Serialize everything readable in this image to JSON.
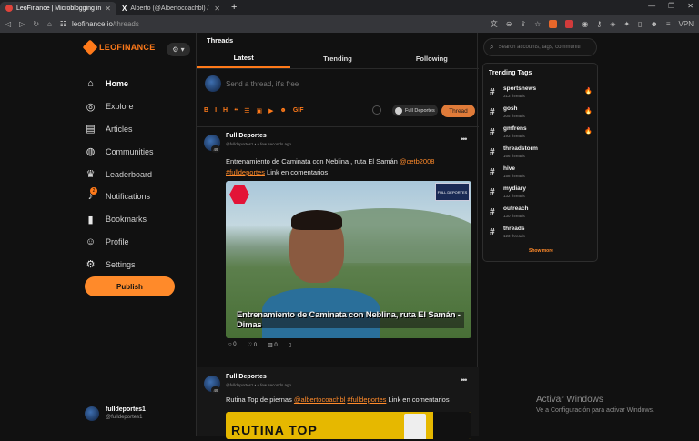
{
  "browser": {
    "tabs": [
      {
        "title": "LeoFinance | Microblogging in Bl",
        "close": "✕"
      },
      {
        "title": "Alberto (@Albertocoachbl) / X",
        "close": "✕"
      }
    ],
    "new_tab": "+",
    "url_host": "leofinance.io",
    "url_path": "/threads",
    "vpn_label": "VPN",
    "window_controls": [
      "—",
      "❐",
      "✕"
    ]
  },
  "sidebar": {
    "logo_text": "LEOFINANCE",
    "settings_button": "⚙ ▾",
    "nav": [
      {
        "label": "Home",
        "icon": "home-icon",
        "glyph": "⌂"
      },
      {
        "label": "Explore",
        "icon": "compass-icon",
        "glyph": "◎"
      },
      {
        "label": "Articles",
        "icon": "newspaper-icon",
        "glyph": "▤"
      },
      {
        "label": "Communities",
        "icon": "globe-icon",
        "glyph": "◍"
      },
      {
        "label": "Leaderboard",
        "icon": "trophy-icon",
        "glyph": "♛"
      },
      {
        "label": "Notifications",
        "icon": "bell-icon",
        "glyph": "♪",
        "badge": "2"
      },
      {
        "label": "Bookmarks",
        "icon": "bookmark-icon",
        "glyph": "▮"
      },
      {
        "label": "Profile",
        "icon": "user-icon",
        "glyph": "☺"
      },
      {
        "label": "Settings",
        "icon": "gear-icon",
        "glyph": "⚙"
      }
    ],
    "publish_label": "Publish",
    "user": {
      "name": "fulldeportes1",
      "handle": "@fulldeportes1",
      "more": "..."
    }
  },
  "main": {
    "title": "Threads",
    "tabs": [
      "Latest",
      "Trending",
      "Following"
    ],
    "compose": {
      "placeholder": "Send a thread, it's free",
      "toolbar": [
        "B",
        "I",
        "H",
        "❝",
        "☰",
        "▣",
        "▶",
        "☻",
        "GIF"
      ],
      "community": "Full Deportes",
      "thread_button": "Thread"
    },
    "posts": [
      {
        "name": "Full Deportes",
        "handle": "@fulldeportes1",
        "time": "a few seconds ago",
        "level": "49",
        "text_before": "Entrenamiento de Caminata con Neblina , ruta El Samán ",
        "mention": "@cetb2008",
        "hashtag": "#fulldeportes",
        "text_after": " Link en comentarios",
        "image_caption": "Entrenamiento de Caminata con Neblina, ruta El Samán - Dimas",
        "image_badge": "FULL DEPORTES",
        "stats": {
          "comments": "0",
          "likes": "0",
          "votes": "0"
        }
      },
      {
        "name": "Full Deportes",
        "handle": "@fulldeportes1",
        "time": "a few seconds ago",
        "level": "49",
        "text_before": "Rutina Top de piernas ",
        "mention": "@albertocoachbl",
        "hashtag": "#fulldeportes",
        "text_after": " Link en comentarios",
        "image_text": "RUTINA TOP"
      }
    ]
  },
  "right": {
    "search_placeholder": "Search accounts, tags, communiti",
    "trending_title": "Trending Tags",
    "tags": [
      {
        "name": "sportsnews",
        "count": "313 threads",
        "hot": true
      },
      {
        "name": "gosh",
        "count": "305 threads",
        "hot": true
      },
      {
        "name": "gmfrens",
        "count": "193 threads",
        "hot": true
      },
      {
        "name": "threadstorm",
        "count": "166 threads",
        "hot": false
      },
      {
        "name": "hive",
        "count": "158 threads",
        "hot": false
      },
      {
        "name": "mydiary",
        "count": "132 threads",
        "hot": false
      },
      {
        "name": "outreach",
        "count": "130 threads",
        "hot": false
      },
      {
        "name": "threads",
        "count": "123 threads",
        "hot": false
      }
    ],
    "show_more": "Show more"
  },
  "watermark": {
    "title": "Activar Windows",
    "subtitle": "Ve a Configuración para activar Windows."
  }
}
